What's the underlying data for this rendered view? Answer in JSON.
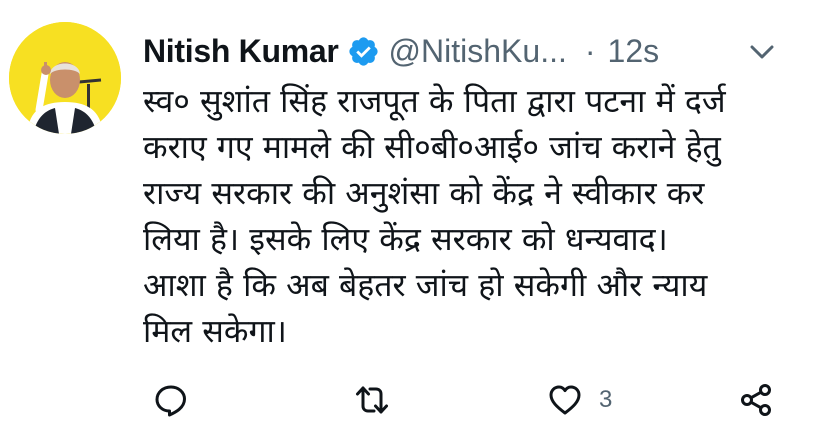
{
  "author": {
    "name": "Nitish Kumar",
    "handle": "@NitishKu...",
    "separator": "·",
    "time": "12s",
    "verified": true
  },
  "tweet": {
    "lines": [
      "स्व० सुशांत सिंह राजपूत के पिता द्वारा पटना में दर्ज",
      "कराए गए मामले की सी०बी०आई० जांच कराने हेतु",
      "राज्य सरकार की अनुशंसा को केंद्र ने स्वीकार कर",
      "लिया है। इसके लिए केंद्र सरकार को धन्यवाद।",
      "आशा है कि अब बेहतर जांच हो सकेगी और न्याय",
      "मिल सकेगा।"
    ]
  },
  "actions": {
    "reply_icon": "reply-icon",
    "retweet_icon": "retweet-icon",
    "like_icon": "heart-icon",
    "like_count": "3",
    "share_icon": "share-icon"
  },
  "colors": {
    "text": "#0f1419",
    "muted": "#536471",
    "verified": "#1d9bf0",
    "avatar_bg": "#f7e022"
  }
}
